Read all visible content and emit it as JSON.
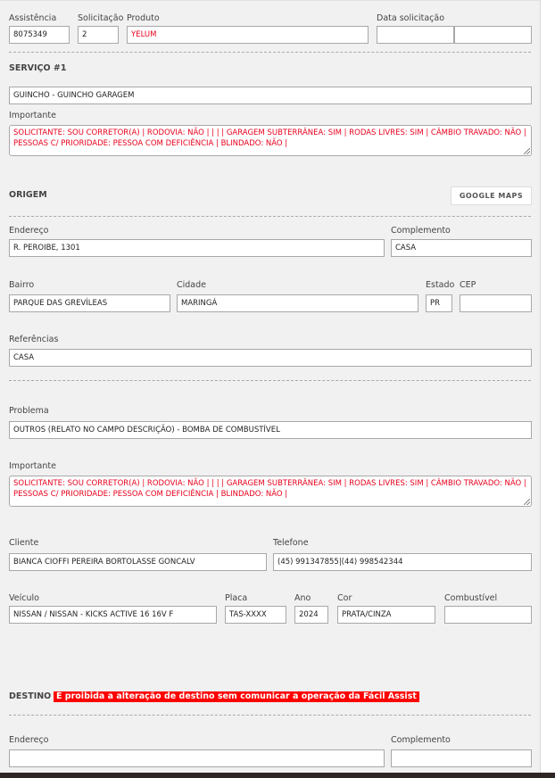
{
  "header": {
    "assistencia": {
      "label": "Assistência",
      "value": "8075349"
    },
    "solicitacao": {
      "label": "Solicitação",
      "value": "2"
    },
    "produto": {
      "label": "Produto",
      "value": "YELUM"
    },
    "data_solicitacao": {
      "label": "Data solicitação",
      "date": "",
      "time": ""
    }
  },
  "servico": {
    "title": "SERVIÇO #1",
    "service": "GUINCHO - GUINCHO GARAGEM",
    "importante_label": "Importante",
    "importante_text": "SOLICITANTE: SOU CORRETOR(A) | RODOVIA: NÃO |  |  |  | GARAGEM SUBTERRÂNEA: SIM | RODAS LIVRES: SIM | CÂMBIO TRAVADO: NÃO | PESSOAS C/ PRIORIDADE: PESSOA COM DEFICIÊNCIA | BLINDADO: NÃO |"
  },
  "origem": {
    "title": "ORIGEM",
    "google_maps_label": "GOOGLE MAPS",
    "endereco": {
      "label": "Endereço",
      "value": "R. PEROIBE, 1301"
    },
    "complemento": {
      "label": "Complemento",
      "value": "CASA"
    },
    "bairro": {
      "label": "Bairro",
      "value": "PARQUE DAS GREVÍLEAS"
    },
    "cidade": {
      "label": "Cidade",
      "value": "MARINGÁ"
    },
    "estado": {
      "label": "Estado",
      "value": "PR"
    },
    "cep": {
      "label": "CEP",
      "value": ""
    },
    "referencias": {
      "label": "Referências",
      "value": "CASA"
    }
  },
  "problema": {
    "label": "Problema",
    "value": "OUTROS (RELATO NO CAMPO DESCRIÇÃO) - BOMBA DE COMBUSTÍVEL",
    "importante_label": "Importante",
    "importante_text": "SOLICITANTE: SOU CORRETOR(A) | RODOVIA: NÃO |  |  |  | GARAGEM SUBTERRÂNEA: SIM | RODAS LIVRES: SIM | CÂMBIO TRAVADO: NÃO | PESSOAS C/ PRIORIDADE: PESSOA COM DEFICIÊNCIA | BLINDADO: NÃO |"
  },
  "cliente": {
    "cliente": {
      "label": "Cliente",
      "value": "BIANCA CIOFFI PEREIRA BORTOLASSE GONCALV"
    },
    "telefone": {
      "label": "Telefone",
      "value": "(45) 991347855|(44) 998542344"
    }
  },
  "veiculo": {
    "veiculo": {
      "label": "Veículo",
      "value": "NISSAN / NISSAN - KICKS ACTIVE 16 16V F"
    },
    "placa": {
      "label": "Placa",
      "value": "TAS-XXXX"
    },
    "ano": {
      "label": "Ano",
      "value": "2024"
    },
    "cor": {
      "label": "Cor",
      "value": "PRATA/CINZA"
    },
    "combustivel": {
      "label": "Combustível",
      "value": ""
    }
  },
  "destino": {
    "title": "DESTINO",
    "warning": "É proibida a alteração de destino sem comunicar a operação da Fácil Assist",
    "endereco": {
      "label": "Endereço",
      "value": ""
    },
    "complemento": {
      "label": "Complemento",
      "value": ""
    }
  }
}
